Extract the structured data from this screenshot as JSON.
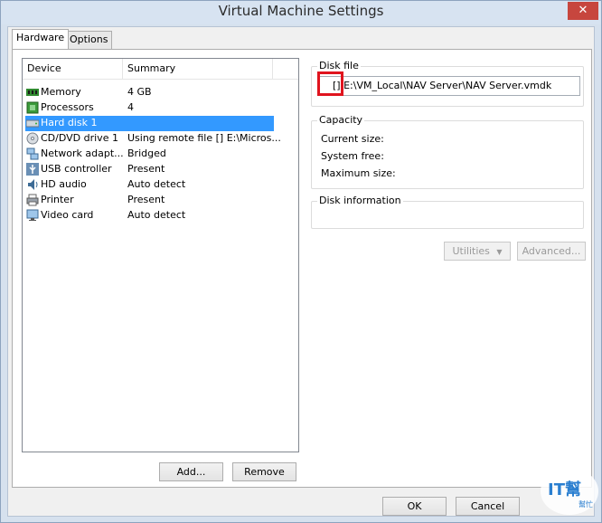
{
  "window": {
    "title": "Virtual Machine Settings"
  },
  "tabs": [
    {
      "label": "Hardware",
      "active": true
    },
    {
      "label": "Options",
      "active": false
    }
  ],
  "device_list": {
    "columns": [
      "Device",
      "Summary"
    ],
    "rows": [
      {
        "device": "Memory",
        "summary": "4 GB",
        "icon": "memory-icon"
      },
      {
        "device": "Processors",
        "summary": "4",
        "icon": "processor-icon"
      },
      {
        "device": "Hard disk 1",
        "summary": "",
        "icon": "hard-disk-icon",
        "selected": true
      },
      {
        "device": "CD/DVD drive 1",
        "summary": "Using remote file [] E:\\Micros...",
        "icon": "cd-dvd-icon"
      },
      {
        "device": "Network adapt...",
        "summary": "Bridged",
        "icon": "network-icon"
      },
      {
        "device": "USB controller",
        "summary": "Present",
        "icon": "usb-icon"
      },
      {
        "device": "HD audio",
        "summary": "Auto detect",
        "icon": "audio-icon"
      },
      {
        "device": "Printer",
        "summary": "Present",
        "icon": "printer-icon"
      },
      {
        "device": "Video card",
        "summary": "Auto detect",
        "icon": "video-card-icon"
      }
    ]
  },
  "list_buttons": {
    "add": "Add...",
    "remove": "Remove"
  },
  "disk_file": {
    "label": "Disk file",
    "value": "[] E:\\VM_Local\\NAV Server\\NAV Server.vmdk"
  },
  "capacity": {
    "label": "Capacity",
    "current_size": "Current size:",
    "system_free": "System free:",
    "maximum_size": "Maximum size:"
  },
  "disk_information": {
    "label": "Disk information"
  },
  "disk_buttons": {
    "utilities": "Utilities",
    "advanced": "Advanced..."
  },
  "footer": {
    "ok": "OK",
    "cancel": "Cancel"
  },
  "watermark": {
    "text": "IT幫",
    "subtext": "幫忙"
  },
  "colors": {
    "selection": "#3399ff",
    "close": "#c7463e",
    "highlight": "#e0141e"
  }
}
